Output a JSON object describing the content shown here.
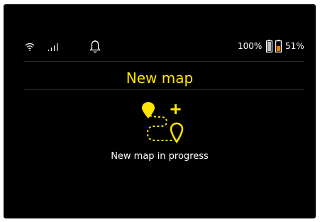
{
  "status_bar": {
    "wifi_icon": "wifi-icon",
    "signal_icon": "signal-icon",
    "bell_icon": "bell-icon",
    "battery_primary_text": "100%",
    "battery_primary_level": 1.0,
    "battery_secondary_text": "51%",
    "battery_secondary_level": 0.51
  },
  "main": {
    "title": "New map",
    "icon": "new-map-route-icon",
    "message": "New map in progress"
  },
  "colors": {
    "accent": "#ffe600",
    "background": "#000000",
    "text": "#ffffff",
    "battery_warning": "#ff7a00",
    "divider": "#2b2b2b"
  }
}
